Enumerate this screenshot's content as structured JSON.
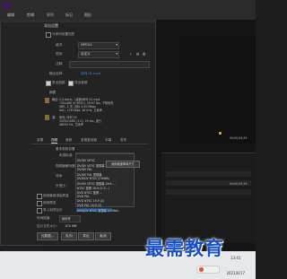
{
  "menubar": {
    "items": [
      "编辑",
      "剪辑",
      "序列",
      "标记",
      "图形"
    ]
  },
  "dialog": {
    "title": "导出设置",
    "match_sequence_label": "与序列设置匹配",
    "format_label": "格式:",
    "format_value": "MPEG4",
    "preset_label": "预设:",
    "preset_value": "自定义",
    "comment_label": "注释:",
    "output_name_label": "输出名称:",
    "output_name_value": "序列 01.mp4",
    "export_video_label": "导出视频",
    "export_audio_label": "导出音频",
    "summary_heading": "摘要",
    "summary_output_label": "输出:",
    "summary_output_lines": [
      "C:\\Users\\...\\桌面\\序列 01.mp4",
      "720x480 (0.9091), 29.97 fps, 下场优先",
      "VBR, 1 次, 目标 4.00 Mbps",
      "AAC, 128 kbps, 48 kHz, 立体声"
    ],
    "summary_source_label": "源:",
    "summary_source_lines": [
      "序列, 序列 01",
      "1920x1080 (1.0), 25 fps, 逐行",
      "48000 Hz, 立体声"
    ],
    "tabs": [
      "效果",
      "视频",
      "音频",
      "多路复用器",
      "字幕",
      "发布"
    ],
    "video_codec_label": "视频编解码器",
    "basic_label": "基本视频设置",
    "dimension_label": "宽度",
    "standard_label": "电视标准:",
    "standard_value": "DV/DV NTSC 宽银幕",
    "field_order_label": "场序:",
    "aspect_label": "长宽比:",
    "tv_standard_label": "电视标准:",
    "dropdown_options": [
      "DV/DV NTSC 宽银幕",
      "DV/DV NTSC",
      "DV/DV NTSC 宽银幕 24p (2:3:3:2)",
      "DV/DV PAL",
      "DV/DV PAL 宽银幕",
      "DVD/DV NTSC (CHINA)",
      "DV/DV NTSC 宽银幕 16:9 ...",
      "NTSC 宽屏 16:9 (2:3...)",
      "DVD NTSC 宽屏 ...",
      "DVD PAL",
      "DVD NTSC 16:9 (2)",
      "DVD PAL 16:9 (2)",
      "DVD/DV NTSC 宽银幕 (CHINA)"
    ],
    "tooltip": "使用帧速率和尺寸",
    "max_depth_label": "使用最高渲染质量",
    "use_preview_label": "使用预览",
    "import_project_label": "导入到项目中",
    "time_interp_label": "时间插值:",
    "time_interp_value": "帧采样",
    "file_size_label": "估计文件大小:",
    "file_size_value": "105 MB",
    "buttons": {
      "metadata": "元数据...",
      "queue": "队列",
      "export": "导出",
      "cancel": "取消"
    }
  },
  "background": {
    "timecode_left": "00;00;00;00",
    "timecode_right": "00;00;04;29",
    "timecode_right2": "00;00;09;29"
  },
  "taskbar": {
    "time": "13:41",
    "date": "2021/6/17"
  },
  "watermark": {
    "text": "最需教育"
  }
}
